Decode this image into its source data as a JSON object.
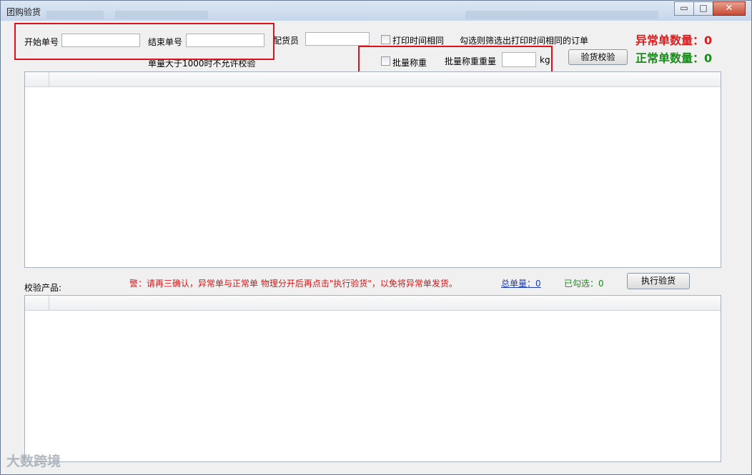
{
  "window": {
    "title": "团购验货",
    "minimize_glyph": "▭",
    "maximize_glyph": "□",
    "close_glyph": "✕"
  },
  "filters": {
    "start_order_label": "开始单号",
    "start_order_value": "",
    "end_order_label": "结束单号",
    "end_order_value": "",
    "picker_label": "配货员",
    "picker_value": "",
    "limit_note": "单量大于1000时不允许校验",
    "same_print_time_label": "打印时间相同",
    "same_print_time_checked": false,
    "same_print_time_hint": "勾选则筛选出打印时间相同的订单",
    "batch_weigh_label": "批量称重",
    "batch_weigh_checked": false,
    "batch_weight_label": "批量称重重量",
    "batch_weight_value": "",
    "batch_weight_unit": "kg",
    "verify_button": "验货校验"
  },
  "counts": {
    "abnormal_label": "异常单数量：",
    "abnormal_value": "0",
    "normal_label": "正常单数量：",
    "normal_value": "0",
    "abnormal_color": "#e01b1b",
    "normal_color": "#1a8a1a"
  },
  "products": {
    "section_label": "校验产品:",
    "warning": "警：请再三确认，异常单与正常单 物理分开后再点击\"执行验货\"，以免将异常单发货。",
    "total_label": "总单量：0",
    "checked_label": "已勾选：0",
    "execute_button": "执行验货"
  },
  "watermark": "大数跨境"
}
